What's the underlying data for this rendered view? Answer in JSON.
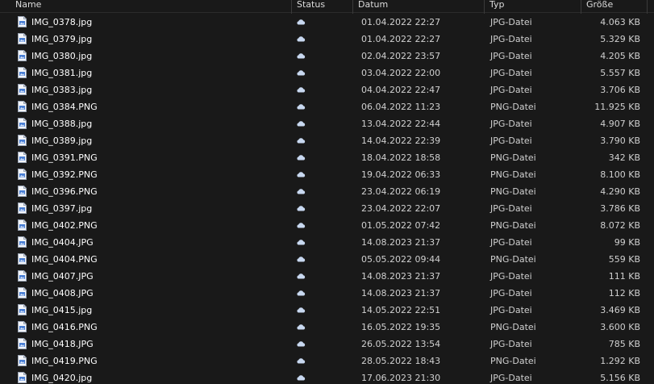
{
  "columns": {
    "name": "Name",
    "status": "Status",
    "date": "Datum",
    "type": "Typ",
    "size": "Größe"
  },
  "icons": {
    "file": "image-file-icon",
    "status": "cloud-icon"
  },
  "colors": {
    "background": "#191919",
    "cloud": "#c8d8f0",
    "file_icon_accent": "#4a7fd4"
  },
  "files": [
    {
      "name": "IMG_0378.jpg",
      "date": "01.04.2022 22:27",
      "type": "JPG-Datei",
      "size": "4.063 KB"
    },
    {
      "name": "IMG_0379.jpg",
      "date": "01.04.2022 22:27",
      "type": "JPG-Datei",
      "size": "5.329 KB"
    },
    {
      "name": "IMG_0380.jpg",
      "date": "02.04.2022 23:57",
      "type": "JPG-Datei",
      "size": "4.205 KB"
    },
    {
      "name": "IMG_0381.jpg",
      "date": "03.04.2022 22:00",
      "type": "JPG-Datei",
      "size": "5.557 KB"
    },
    {
      "name": "IMG_0383.jpg",
      "date": "04.04.2022 22:47",
      "type": "JPG-Datei",
      "size": "3.706 KB"
    },
    {
      "name": "IMG_0384.PNG",
      "date": "06.04.2022 11:23",
      "type": "PNG-Datei",
      "size": "11.925 KB"
    },
    {
      "name": "IMG_0388.jpg",
      "date": "13.04.2022 22:44",
      "type": "JPG-Datei",
      "size": "4.907 KB"
    },
    {
      "name": "IMG_0389.jpg",
      "date": "14.04.2022 22:39",
      "type": "JPG-Datei",
      "size": "3.790 KB"
    },
    {
      "name": "IMG_0391.PNG",
      "date": "18.04.2022 18:58",
      "type": "PNG-Datei",
      "size": "342 KB"
    },
    {
      "name": "IMG_0392.PNG",
      "date": "19.04.2022 06:33",
      "type": "PNG-Datei",
      "size": "8.100 KB"
    },
    {
      "name": "IMG_0396.PNG",
      "date": "23.04.2022 06:19",
      "type": "PNG-Datei",
      "size": "4.290 KB"
    },
    {
      "name": "IMG_0397.jpg",
      "date": "23.04.2022 22:07",
      "type": "JPG-Datei",
      "size": "3.786 KB"
    },
    {
      "name": "IMG_0402.PNG",
      "date": "01.05.2022 07:42",
      "type": "PNG-Datei",
      "size": "8.072 KB"
    },
    {
      "name": "IMG_0404.JPG",
      "date": "14.08.2023 21:37",
      "type": "JPG-Datei",
      "size": "99 KB"
    },
    {
      "name": "IMG_0404.PNG",
      "date": "05.05.2022 09:44",
      "type": "PNG-Datei",
      "size": "559 KB"
    },
    {
      "name": "IMG_0407.JPG",
      "date": "14.08.2023 21:37",
      "type": "JPG-Datei",
      "size": "111 KB"
    },
    {
      "name": "IMG_0408.JPG",
      "date": "14.08.2023 21:37",
      "type": "JPG-Datei",
      "size": "112 KB"
    },
    {
      "name": "IMG_0415.jpg",
      "date": "14.05.2022 22:51",
      "type": "JPG-Datei",
      "size": "3.469 KB"
    },
    {
      "name": "IMG_0416.PNG",
      "date": "16.05.2022 19:35",
      "type": "PNG-Datei",
      "size": "3.600 KB"
    },
    {
      "name": "IMG_0418.JPG",
      "date": "26.05.2022 13:54",
      "type": "JPG-Datei",
      "size": "785 KB"
    },
    {
      "name": "IMG_0419.PNG",
      "date": "28.05.2022 18:43",
      "type": "PNG-Datei",
      "size": "1.292 KB"
    },
    {
      "name": "IMG_0420.jpg",
      "date": "17.06.2023 21:30",
      "type": "JPG-Datei",
      "size": "5.156 KB"
    }
  ]
}
